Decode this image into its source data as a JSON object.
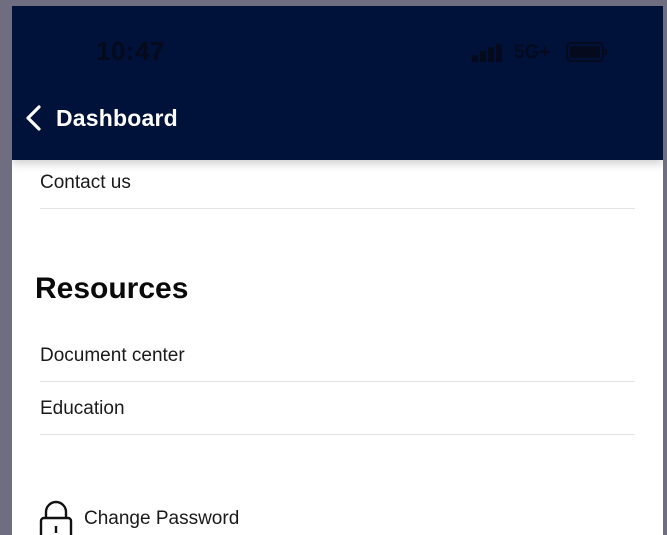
{
  "status_bar": {
    "time": "10:47",
    "network": "5G+"
  },
  "header": {
    "back_label": "Dashboard"
  },
  "menu": {
    "contact_label": "Contact us"
  },
  "resources": {
    "title": "Resources",
    "items": [
      {
        "label": "Document center"
      },
      {
        "label": "Education"
      }
    ]
  },
  "account": {
    "change_password_label": "Change Password"
  },
  "colors": {
    "header_bg": "#00113a",
    "text": "#1a1a1a",
    "divider": "#e3e3e3"
  }
}
